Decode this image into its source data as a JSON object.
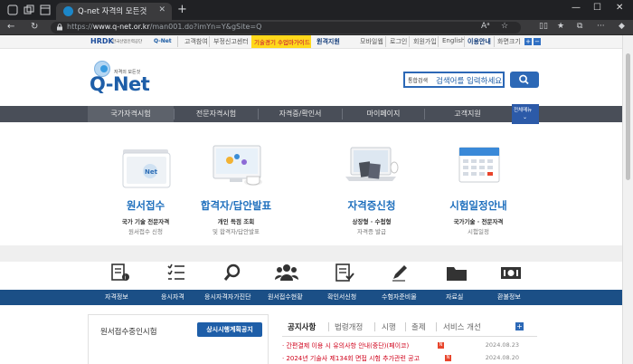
{
  "browser": {
    "tab_title": "Q-net 자격의 모든것",
    "url_prefix": "https://",
    "url_host": "www.q-net.or.kr",
    "url_path": "/man001.do?imYn=Y&gSite=Q"
  },
  "util_bar": {
    "org_logo": "HRDK",
    "org_name": "한국산업인력공단",
    "qnet_mini": "Q-Net",
    "links": [
      "고객참여",
      "부정신고센터",
      "기술경기 수업마가이드",
      "원격지원",
      "로그인",
      "회원가입",
      "English",
      "이용안내",
      "화면크기"
    ],
    "left_links": [
      "고객참여",
      "부정신고센터"
    ],
    "highlight_link": "기술경기 수업마가이드",
    "remote_link": "원격지원",
    "right_links": [
      "모바일웹",
      "로그인",
      "회원가입",
      "English"
    ],
    "guide_link": "이용안내",
    "zoom_label": "화면크기",
    "zoom_plus": "+",
    "zoom_minus": "−"
  },
  "header": {
    "logo_text": "Q-Net",
    "logo_sub": "자격의 모든것",
    "search_category": "통합검색",
    "search_placeholder": "검색어를 입력하세요"
  },
  "gnb": {
    "items": [
      "국가자격시험",
      "전문자격시험",
      "자격증/확인서",
      "마이페이지",
      "고객지원"
    ],
    "allmenu": "전체메뉴"
  },
  "services": [
    {
      "title": "원서접수",
      "sub1": "국가 기술 전문자격",
      "sub2": "원서접수 신청"
    },
    {
      "title": "합격자/답안발표",
      "sub1": "개인 득점 조회",
      "sub2": "및 합격자/답안발표"
    },
    {
      "title": "자격증신청",
      "sub1": "상장형 · 수첩형",
      "sub2": "자격증 발급"
    },
    {
      "title": "시험일정안내",
      "sub1": "국가기술 · 전문자격",
      "sub2": "시험일정"
    }
  ],
  "quick_menu": [
    "자격정보",
    "응시자격",
    "응시자격자가진단",
    "원서접수현황",
    "확인서신청",
    "수험자준비물",
    "자료실",
    "환불정보"
  ],
  "left_panel": {
    "title": "원서접수중인시험",
    "button": "상시시행계획공지"
  },
  "right_panel": {
    "tabs": [
      "공지사항",
      "법령개정",
      "시행",
      "출제",
      "서비스 개선"
    ],
    "plus": "+",
    "notices": [
      {
        "text": "· 간편결제 이용 시 유의사항 안내(중단)(페이코)",
        "date": "2024.08.23"
      },
      {
        "text": "· 2024년 기술사 제134회 면접 시험 추가관련 공고",
        "date": "2024.08.20"
      }
    ]
  },
  "colors": {
    "brand_blue": "#1e5ea8",
    "gnb_bg": "#494e58",
    "quick_bar": "#1b4f86",
    "highlight_yellow": "#ffd81b",
    "notice_red": "#d0021b"
  }
}
